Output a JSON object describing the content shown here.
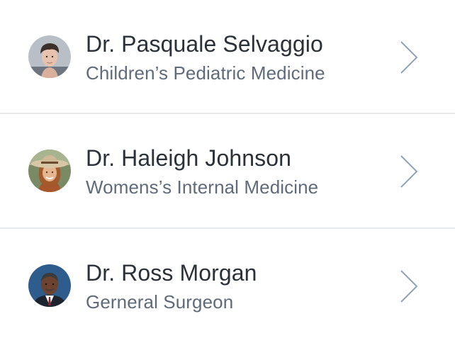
{
  "doctors": [
    {
      "name": "Dr. Pasquale Selvaggio",
      "specialty": "Children’s Pediatric Medicine",
      "avatar_icon": "doctor-avatar-man-dark-hair"
    },
    {
      "name": "Dr. Haleigh Johnson",
      "specialty": "Womens’s Internal Medicine",
      "avatar_icon": "doctor-avatar-woman-hat"
    },
    {
      "name": "Dr. Ross Morgan",
      "specialty": "Gerneral Surgeon",
      "avatar_icon": "doctor-avatar-man-suit"
    }
  ],
  "colors": {
    "name_text": "#2b3138",
    "specialty_text": "#5f6b7a",
    "chevron": "#8fa3b8",
    "divider": "#e6e8eb",
    "background": "#ffffff"
  },
  "icons": {
    "row_action": "chevron-right-icon"
  }
}
